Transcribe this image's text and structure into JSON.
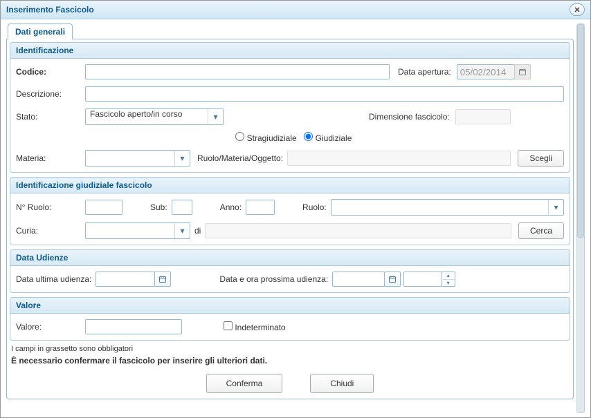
{
  "window": {
    "title": "Inserimento Fascicolo"
  },
  "tabs": {
    "dati_generali": "Dati generali"
  },
  "identificazione": {
    "title": "Identificazione",
    "codice_label": "Codice:",
    "codice_value": "",
    "data_apertura_label": "Data apertura:",
    "data_apertura_value": "05/02/2014",
    "descrizione_label": "Descrizione:",
    "descrizione_value": "",
    "stato_label": "Stato:",
    "stato_value": "Fascicolo aperto/in corso",
    "dimensione_label": "Dimensione fascicolo:",
    "dimensione_value": "",
    "radio_stragiudiziale": "Stragiudiziale",
    "radio_giudiziale": "Giudiziale",
    "materia_label": "Materia:",
    "materia_value": "",
    "rmo_label": "Ruolo/Materia/Oggetto:",
    "rmo_value": "",
    "scegli_btn": "Scegli"
  },
  "identificazione_giud": {
    "title": "Identificazione giudiziale fascicolo",
    "nruolo_label": "N° Ruolo:",
    "nruolo_value": "",
    "sub_label": "Sub:",
    "sub_value": "",
    "anno_label": "Anno:",
    "anno_value": "",
    "ruolo_label": "Ruolo:",
    "ruolo_value": "",
    "curia_label": "Curia:",
    "curia_value": "",
    "di_label": "di",
    "di_value": "",
    "cerca_btn": "Cerca"
  },
  "udienze": {
    "title": "Data Udienze",
    "ultima_label": "Data ultima udienza:",
    "ultima_value": "",
    "prossima_label": "Data e ora prossima udienza:",
    "prossima_date_value": "",
    "prossima_time_value": ""
  },
  "valore": {
    "title": "Valore",
    "valore_label": "Valore:",
    "valore_value": "",
    "indeterminato_label": "Indeterminato"
  },
  "footer": {
    "note1": "I campi in grassetto sono obbligatori",
    "note2": "È necessario confermare il fascicolo per inserire gli ulteriori dati.",
    "conferma": "Conferma",
    "chiudi": "Chiudi"
  }
}
